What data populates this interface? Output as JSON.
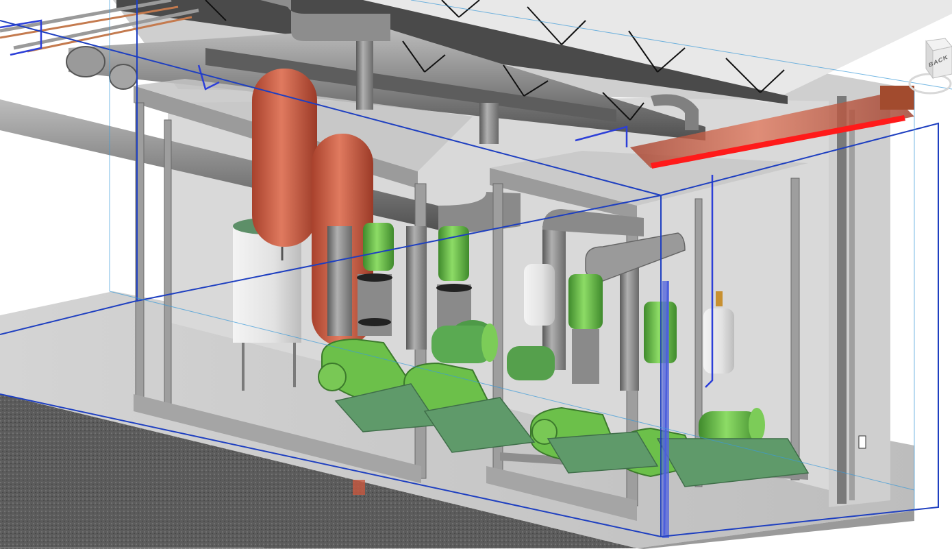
{
  "viewport": {
    "background": "#ffffff",
    "model_colors": {
      "steel": "#a8a8a8",
      "steel_dark": "#6e6e6e",
      "pipe": "#8e8e8e",
      "tank_red": "#c8573f",
      "pump_green": "#6cc04a",
      "base_green": "#5f9a6a",
      "section_box": "#1e3fc0",
      "hot_pipe": "#ff1a1a",
      "copper": "#c47a4e"
    }
  },
  "viewcube": {
    "face_label": "BACK"
  }
}
